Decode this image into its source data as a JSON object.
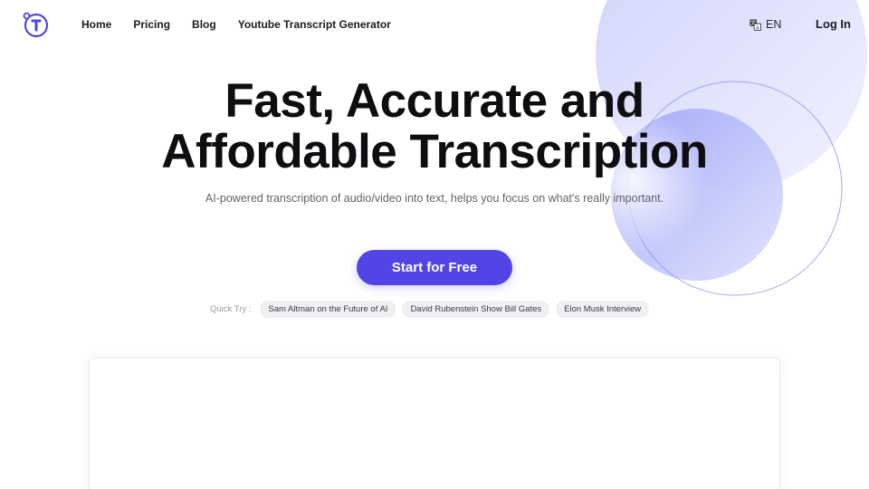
{
  "brand": {
    "logo_icon": "t-logo-icon",
    "accent_color": "#5146e5"
  },
  "nav": {
    "items": [
      {
        "label": "Home"
      },
      {
        "label": "Pricing"
      },
      {
        "label": "Blog"
      },
      {
        "label": "Youtube Transcript Generator"
      }
    ]
  },
  "header": {
    "language": {
      "icon": "translate-icon",
      "label": "EN"
    },
    "login_label": "Log In"
  },
  "hero": {
    "title_line1": "Fast, Accurate and",
    "title_line2": "Affordable Transcription",
    "subtitle": "AI-powered transcription of audio/video into text, helps you focus on what's really important.",
    "cta_label": "Start for Free"
  },
  "quick_try": {
    "label": "Quick Try :",
    "chips": [
      {
        "label": "Sam Altman on the Future of AI"
      },
      {
        "label": "David Rubenstein Show Bill Gates"
      },
      {
        "label": "Elon Musk Interview"
      }
    ]
  }
}
